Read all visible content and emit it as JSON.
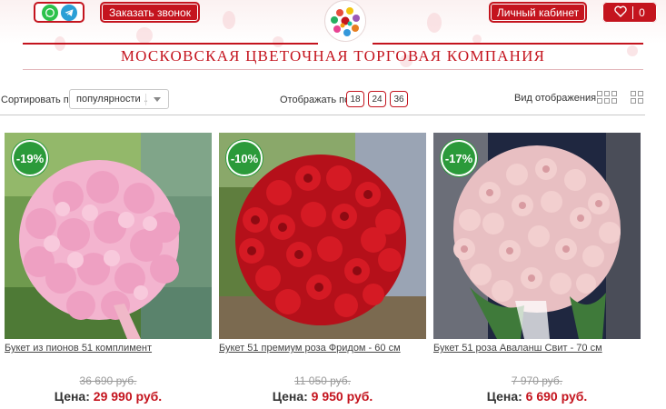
{
  "header": {
    "call_button": "Заказать звонок",
    "cabinet_button": "Личный кабинет",
    "favorites_count": "0",
    "brand": "МОСКОВСКАЯ ЦВЕТОЧНАЯ ТОРГОВАЯ КОМПАНИЯ",
    "icons": [
      "whatsapp-icon",
      "telegram-icon",
      "heart-icon"
    ]
  },
  "toolbar": {
    "sort_label": "Сортировать по:",
    "sort_value": "популярности ↓",
    "show_label": "Отображать по:",
    "page_sizes": [
      "18",
      "24",
      "36"
    ],
    "view_label": "Вид отображения:"
  },
  "products": [
    {
      "discount": "-19%",
      "title": "Букет из пионов 51 комплимент",
      "old_price": "36 690 руб.",
      "price_label": "Цена:",
      "price": "29 990 руб."
    },
    {
      "discount": "-10%",
      "title": "Букет 51 премиум роза Фридом - 60 см",
      "old_price": "11 050 руб.",
      "price_label": "Цена:",
      "price": "9 950 руб."
    },
    {
      "discount": "-17%",
      "title": "Букет 51 роза Аваланш Свит - 70 см",
      "old_price": "7 970 руб.",
      "price_label": "Цена:",
      "price": "6 690 руб."
    }
  ],
  "colors": {
    "accent": "#c4141e",
    "badge": "#2b9a3a"
  }
}
